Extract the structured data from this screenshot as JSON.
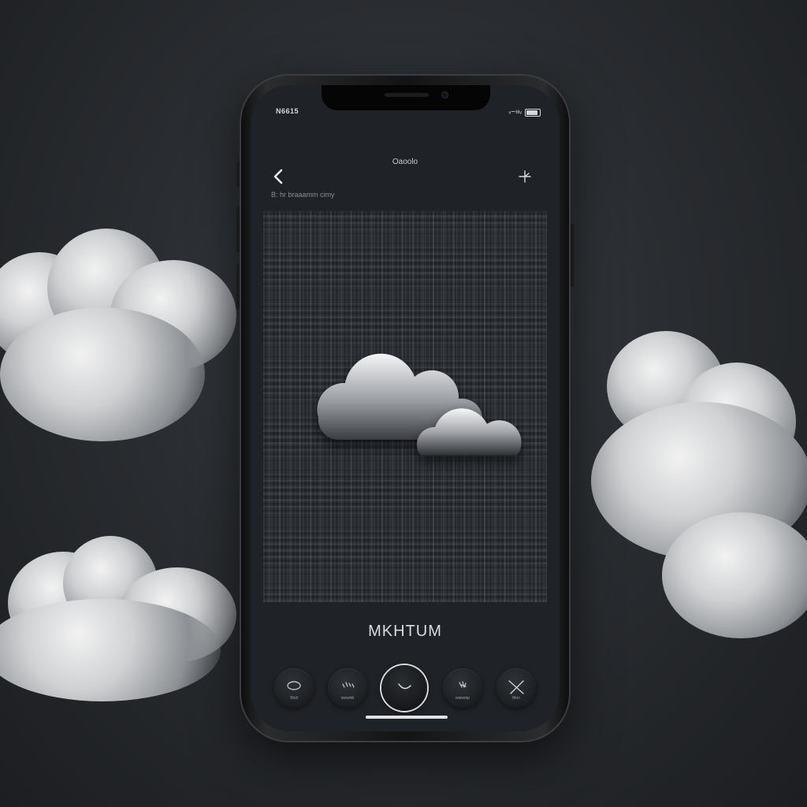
{
  "status_bar": {
    "time": "N6615",
    "right_text": "ᵥ᭸ᥛᵥ"
  },
  "nav": {
    "title": "Oaoolo",
    "subtitle": "B: hr braaamm cimy"
  },
  "brand": "MKHTUM",
  "controls": [
    {
      "label": "Wuli",
      "icon": "ring-icon"
    },
    {
      "label": "wwwnb",
      "icon": "rain-icon"
    },
    {
      "label": "",
      "icon": "curve-icon"
    },
    {
      "label": "wwwmp",
      "icon": "snow-icon"
    },
    {
      "label": "Mon",
      "icon": "wind-icon"
    }
  ],
  "colors": {
    "background": "#2a2d31",
    "screen": "#1f2226",
    "accent": "#d7d9dc"
  }
}
